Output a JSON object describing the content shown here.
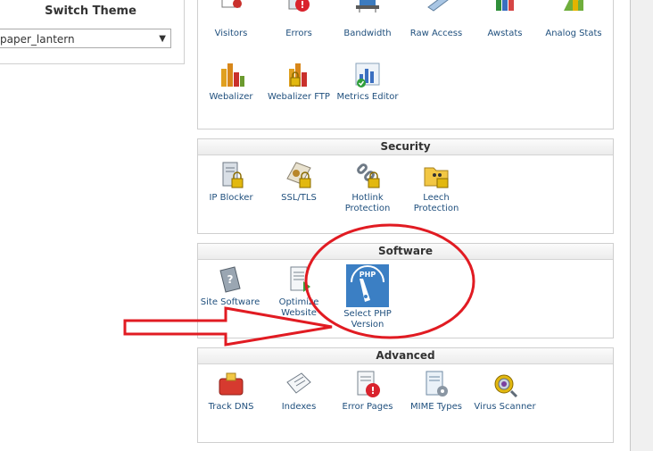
{
  "theme_panel": {
    "title": "Switch Theme",
    "selected": "paper_lantern"
  },
  "stats_group": {
    "items": [
      {
        "label": "Visitors",
        "icon": "visitors-icon"
      },
      {
        "label": "Errors",
        "icon": "errors-icon"
      },
      {
        "label": "Bandwidth",
        "icon": "bandwidth-icon"
      },
      {
        "label": "Raw Access",
        "icon": "raw-access-icon"
      },
      {
        "label": "Awstats",
        "icon": "awstats-icon"
      },
      {
        "label": "Analog Stats",
        "icon": "analog-stats-icon"
      },
      {
        "label": "Webalizer",
        "icon": "webalizer-icon"
      },
      {
        "label": "Webalizer FTP",
        "icon": "webalizer-ftp-icon"
      },
      {
        "label": "Metrics Editor",
        "icon": "metrics-editor-icon"
      }
    ]
  },
  "security": {
    "title": "Security",
    "items": [
      {
        "label1": "IP Blocker",
        "label2": "",
        "icon": "ip-blocker-icon"
      },
      {
        "label1": "SSL/TLS",
        "label2": "",
        "icon": "ssl-tls-icon"
      },
      {
        "label1": "Hotlink",
        "label2": "Protection",
        "icon": "hotlink-protection-icon"
      },
      {
        "label1": "Leech",
        "label2": "Protection",
        "icon": "leech-protection-icon"
      }
    ]
  },
  "software": {
    "title": "Software",
    "items": [
      {
        "label1": "Site Software",
        "label2": "",
        "icon": "site-software-icon"
      },
      {
        "label1": "Optimize",
        "label2": "Website",
        "icon": "optimize-website-icon"
      },
      {
        "label1": "Select PHP",
        "label2": "Version",
        "icon": "select-php-version-icon",
        "icon_text": "PHP"
      }
    ]
  },
  "advanced": {
    "title": "Advanced",
    "items": [
      {
        "label": "Track DNS",
        "icon": "track-dns-icon"
      },
      {
        "label": "Indexes",
        "icon": "indexes-icon"
      },
      {
        "label": "Error Pages",
        "icon": "error-pages-icon"
      },
      {
        "label": "MIME Types",
        "icon": "mime-types-icon"
      },
      {
        "label": "Virus Scanner",
        "icon": "virus-scanner-icon"
      }
    ]
  },
  "colors": {
    "link": "#1f4f7d",
    "annotation_red": "#e11b22",
    "border": "#cfcfcf"
  }
}
